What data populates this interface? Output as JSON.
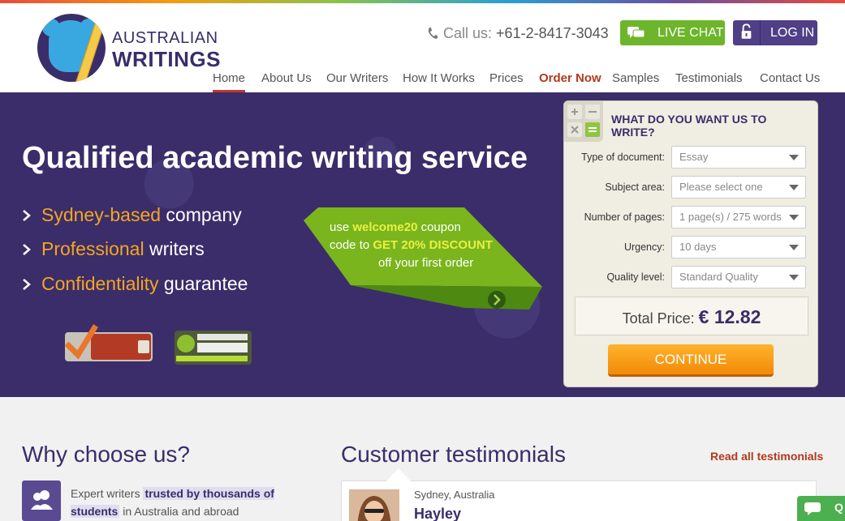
{
  "brand": {
    "line1": "AUSTRALIAN",
    "line2": "WRITINGS"
  },
  "header": {
    "call_label": "Call us:",
    "phone": "+61-2-8417-3043",
    "live_chat": "LIVE CHAT",
    "log_in": "LOG IN"
  },
  "nav": [
    {
      "label": "Home"
    },
    {
      "label": "About Us"
    },
    {
      "label": "Our Writers"
    },
    {
      "label": "How It Works"
    },
    {
      "label": "Prices"
    },
    {
      "label": "Order Now"
    },
    {
      "label": "Samples"
    },
    {
      "label": "Testimonials"
    },
    {
      "label": "Contact Us"
    }
  ],
  "hero": {
    "title": "Qualified academic writing service",
    "bullets": [
      {
        "highlight": "Sydney-based",
        "rest": " company"
      },
      {
        "highlight": "Professional",
        "rest": " writers"
      },
      {
        "highlight": "Confidentiality",
        "rest": " guarantee"
      }
    ],
    "coupon": {
      "pre": "use ",
      "code": "welcome20",
      "post": " coupon",
      "line2_pre": "code to ",
      "discount": "GET 20% DISCOUNT",
      "line3": "off your first order"
    }
  },
  "calculator": {
    "title": "WHAT DO YOU WANT US TO WRITE?",
    "fields": [
      {
        "label": "Type of document:",
        "value": "Essay"
      },
      {
        "label": "Subject area:",
        "value": "Please select one"
      },
      {
        "label": "Number of pages:",
        "value": "1 page(s) / 275 words"
      },
      {
        "label": "Urgency:",
        "value": "10 days"
      },
      {
        "label": "Quality level:",
        "value": "Standard Quality"
      }
    ],
    "total_label": "Total Price:",
    "total_value": "€ 12.82",
    "continue": "CONTINUE"
  },
  "why": {
    "title": "Why choose us?",
    "text_pre": "Expert writers ",
    "text_highlight": "trusted by thousands of students",
    "text_post": " in Australia and abroad"
  },
  "testimonials": {
    "title": "Customer testimonials",
    "read_all": "Read all testimonials",
    "first": {
      "location": "Sydney, Australia",
      "name": "Hayley"
    }
  },
  "colors": {
    "brand_purple": "#3a2d6a",
    "accent_orange": "#f4a523",
    "green": "#6db52b",
    "order_red": "#b03a1c"
  }
}
